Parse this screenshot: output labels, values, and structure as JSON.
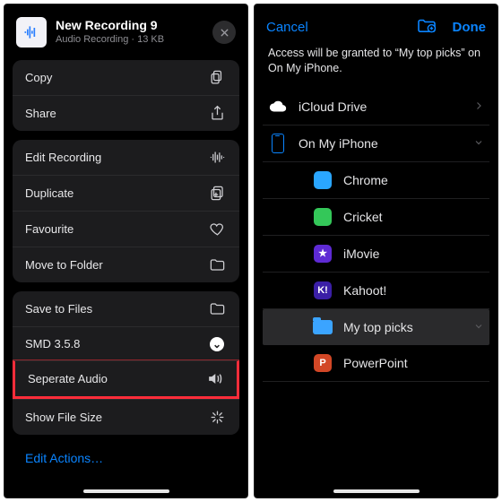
{
  "left": {
    "header": {
      "title": "New Recording 9",
      "subtitle": "Audio Recording · 13 KB"
    },
    "group1": [
      {
        "label": "Copy",
        "icon": "copy"
      },
      {
        "label": "Share",
        "icon": "share"
      }
    ],
    "group2": [
      {
        "label": "Edit Recording",
        "icon": "waveform"
      },
      {
        "label": "Duplicate",
        "icon": "duplicate"
      },
      {
        "label": "Favourite",
        "icon": "heart"
      },
      {
        "label": "Move to Folder",
        "icon": "folder"
      }
    ],
    "group3": [
      {
        "label": "Save to Files",
        "icon": "folder"
      },
      {
        "label": "SMD 3.5.8",
        "icon": "circle-chevron"
      },
      {
        "label": "Seperate Audio",
        "icon": "speaker",
        "highlight": true
      },
      {
        "label": "Show File Size",
        "icon": "sparkle"
      }
    ],
    "edit_actions": "Edit Actions…"
  },
  "right": {
    "cancel": "Cancel",
    "done": "Done",
    "grant_msg": "Access will be granted to “My top picks” on On My iPhone.",
    "locations": {
      "icloud": "iCloud Drive",
      "onmyiphone": "On My iPhone",
      "children": [
        {
          "label": "Chrome",
          "color": "#2aa6ff"
        },
        {
          "label": "Cricket",
          "color": "#34c759"
        },
        {
          "label": "iMovie",
          "color": "#5e2ad4"
        },
        {
          "label": "Kahoot!",
          "color": "#3b1fa6"
        },
        {
          "label": "My top picks",
          "color": "folder",
          "selected": true
        },
        {
          "label": "PowerPoint",
          "color": "#d24726"
        }
      ]
    }
  }
}
